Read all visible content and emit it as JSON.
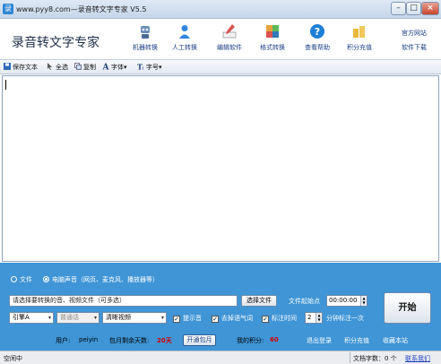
{
  "window": {
    "title": "www.pyy8.com—录音转文字专家 V5.5",
    "min_glyph": "–",
    "max_glyph": "□",
    "close_glyph": "×",
    "icon_glyph": "录"
  },
  "header": {
    "brand": "录音转文字专家",
    "buttons": [
      {
        "label": "机器转换",
        "icon": "robot-icon",
        "color": "#6c8fb8"
      },
      {
        "label": "人工转换",
        "icon": "person-icon",
        "color": "#2e86de"
      },
      {
        "label": "编辑软件",
        "icon": "pen-icon",
        "color": "#d9534f"
      },
      {
        "label": "格式转换",
        "icon": "cube-icon",
        "color": "#e6a23c"
      },
      {
        "label": "查看帮助",
        "icon": "help-icon",
        "color": "#1e7fd6"
      },
      {
        "label": "积分充值",
        "icon": "coins-icon",
        "color": "#e9b83a"
      }
    ],
    "links": {
      "official_site": "官方网站",
      "download": "软件下载"
    }
  },
  "toolbar": {
    "save_text": "保存文本",
    "select_all": "全选",
    "copy": "复制",
    "font": "字体",
    "font_size": "字号",
    "dropdown_glyph": "▾"
  },
  "panel": {
    "source_file": "文件",
    "source_computer": "电脑声音",
    "source_hint": "（网页、麦克风、播放器等）",
    "file_placeholder": "请选择要转换的音、视频文件（可多选）",
    "select_file_button": "选择文件",
    "start_point_label": "文件起始点",
    "start_time": "00:00:00",
    "engine": "引擎A",
    "language": "普通话",
    "quality": "清晰视频",
    "prompt_sound": "提示音",
    "remove_filler": "去掉语气词",
    "timestamp": "标注时间",
    "interval": "2",
    "interval_suffix": "分钟标注一次",
    "start_button": "开始",
    "check_glyph": "✓"
  },
  "info": {
    "user_label": "用户:",
    "user": "peiyin",
    "days_label": "包月剩余天数:",
    "days": "20天",
    "monthly_button": "开通包月",
    "points_label": "我的积分:",
    "points": "60",
    "logout": "退出登录",
    "recharge": "积分充值",
    "favorite": "收藏本站"
  },
  "status": {
    "state": "空闲中",
    "char_count": "文档字数：0 个",
    "contact": "联系我们"
  },
  "colors": {
    "panel": "#3f95d6",
    "link": "#1b3f86",
    "alert": "#d40000"
  }
}
